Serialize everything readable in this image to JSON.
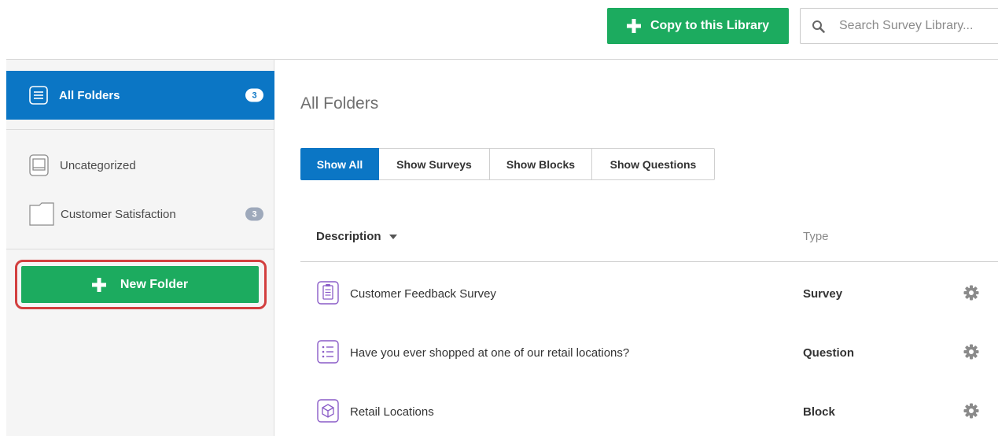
{
  "toolbar": {
    "copy_button_label": "Copy to this Library",
    "search_placeholder": "Search Survey Library..."
  },
  "sidebar": {
    "active_item": {
      "label": "All Folders",
      "count": "3"
    },
    "items": [
      {
        "label": "Uncategorized",
        "count": ""
      },
      {
        "label": "Customer Satisfaction",
        "count": "3"
      }
    ],
    "new_folder_label": "New Folder"
  },
  "main": {
    "title": "All Folders",
    "filters": [
      {
        "label": "Show All",
        "active": true
      },
      {
        "label": "Show Surveys",
        "active": false
      },
      {
        "label": "Show Blocks",
        "active": false
      },
      {
        "label": "Show Questions",
        "active": false
      }
    ],
    "columns": {
      "description": "Description",
      "type": "Type"
    },
    "rows": [
      {
        "description": "Customer Feedback Survey",
        "type": "Survey",
        "icon": "survey-icon"
      },
      {
        "description": "Have you ever shopped at one of our retail locations?",
        "type": "Question",
        "icon": "question-icon"
      },
      {
        "description": "Retail Locations",
        "type": "Block",
        "icon": "block-icon"
      }
    ]
  },
  "colors": {
    "accent_blue": "#0b76c5",
    "green": "#1cab5f",
    "highlight_red": "#d23f3f",
    "item_purple": "#8a5cc7"
  }
}
